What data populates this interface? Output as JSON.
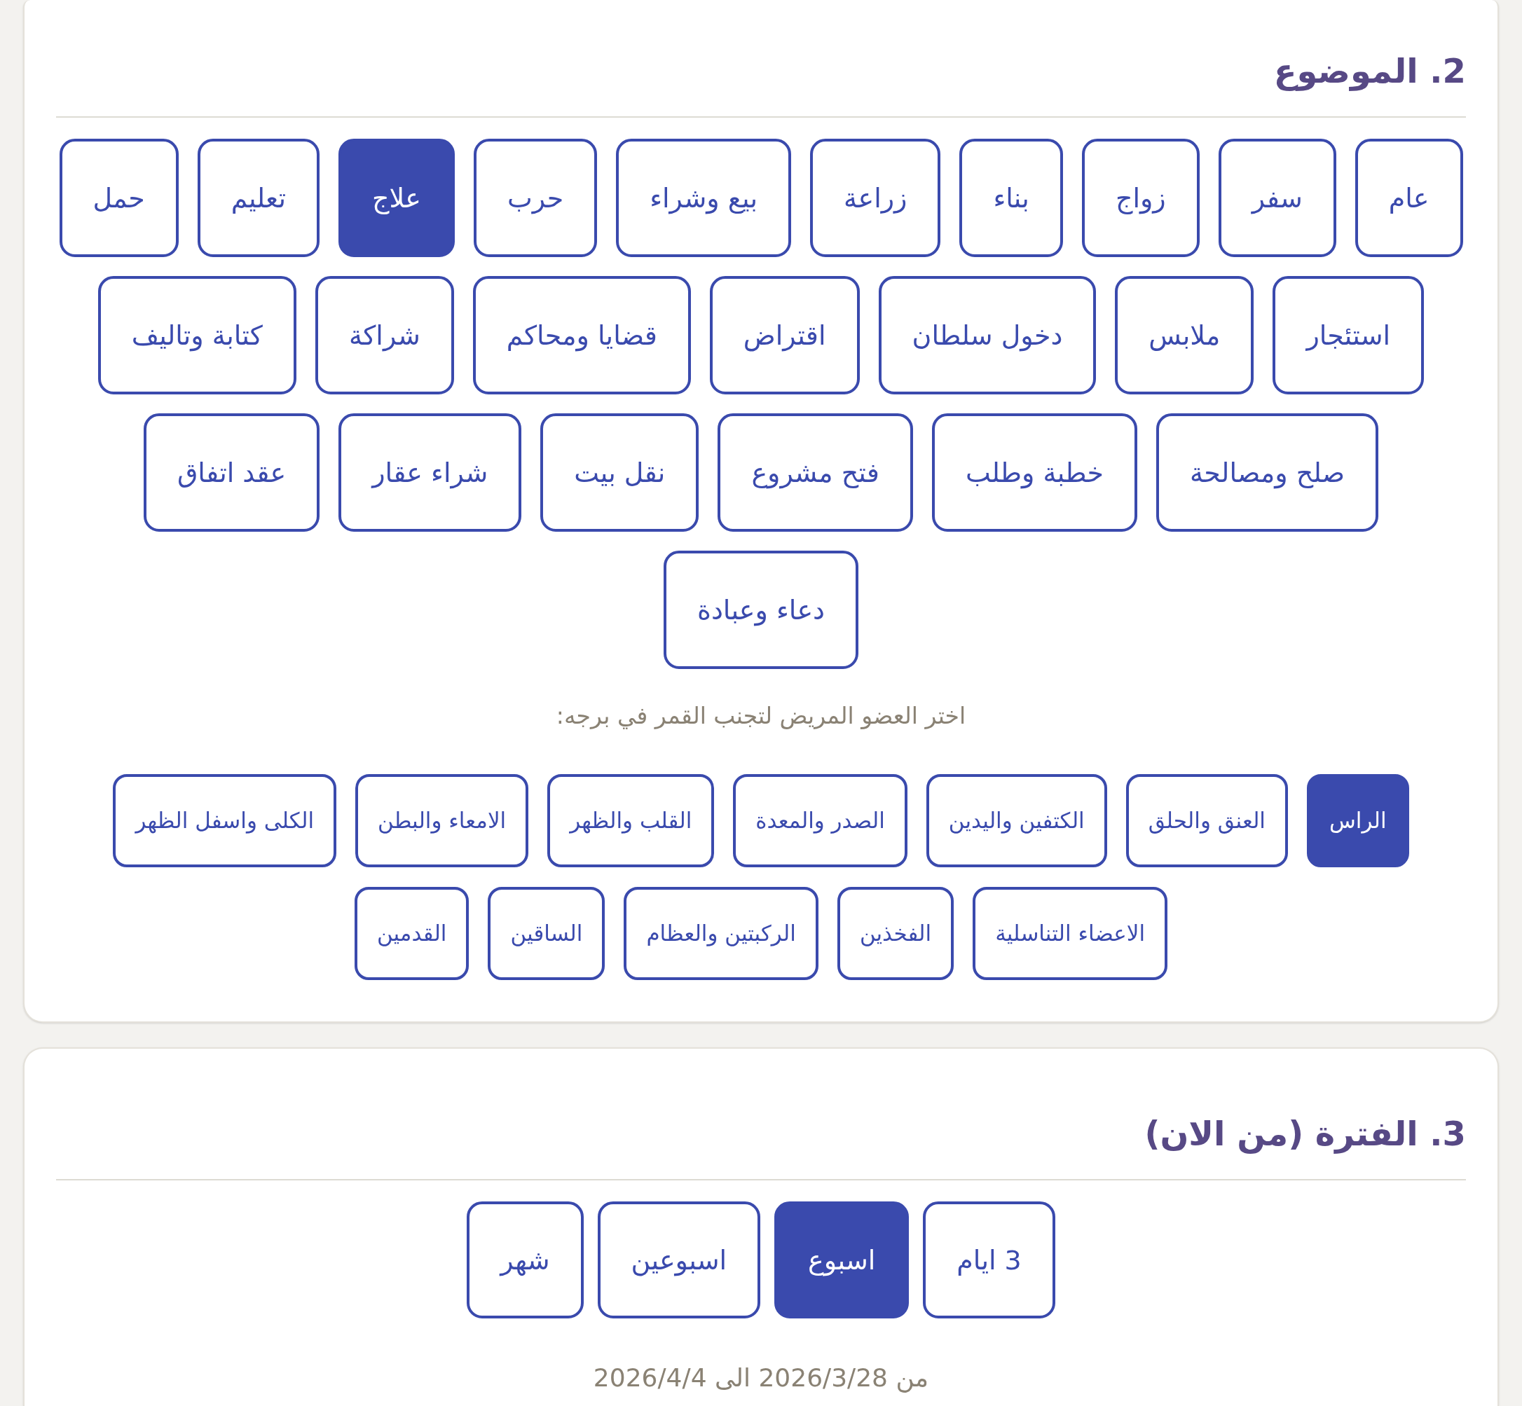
{
  "topic_section": {
    "title": "2. الموضوع",
    "topic_rows": [
      {
        "options": [
          {
            "label": "عام",
            "selected": false
          },
          {
            "label": "سفر",
            "selected": false
          },
          {
            "label": "زواج",
            "selected": false
          },
          {
            "label": "بناء",
            "selected": false
          },
          {
            "label": "زراعة",
            "selected": false
          },
          {
            "label": "بيع وشراء",
            "selected": false
          },
          {
            "label": "حرب",
            "selected": false
          },
          {
            "label": "علاج",
            "selected": true
          },
          {
            "label": "تعليم",
            "selected": false
          },
          {
            "label": "حمل",
            "selected": false
          }
        ]
      },
      {
        "options": [
          {
            "label": "استئجار",
            "selected": false
          },
          {
            "label": "ملابس",
            "selected": false
          },
          {
            "label": "دخول سلطان",
            "selected": false
          },
          {
            "label": "اقتراض",
            "selected": false
          },
          {
            "label": "قضايا ومحاكم",
            "selected": false
          },
          {
            "label": "شراكة",
            "selected": false
          },
          {
            "label": "كتابة وتاليف",
            "selected": false
          }
        ]
      },
      {
        "options": [
          {
            "label": "صلح ومصالحة",
            "selected": false
          },
          {
            "label": "خطبة وطلب",
            "selected": false
          },
          {
            "label": "فتح مشروع",
            "selected": false
          },
          {
            "label": "نقل بيت",
            "selected": false
          },
          {
            "label": "شراء عقار",
            "selected": false
          },
          {
            "label": "عقد اتفاق",
            "selected": false
          }
        ]
      },
      {
        "options": [
          {
            "label": "دعاء وعبادة",
            "selected": false
          }
        ]
      }
    ],
    "hint": "اختر العضو المريض لتجنب القمر في برجه:",
    "body_part_rows": [
      {
        "options": [
          {
            "label": "الراس",
            "selected": true
          },
          {
            "label": "العنق والحلق",
            "selected": false
          },
          {
            "label": "الكتفين واليدين",
            "selected": false
          },
          {
            "label": "الصدر والمعدة",
            "selected": false
          },
          {
            "label": "القلب والظهر",
            "selected": false
          },
          {
            "label": "الامعاء والبطن",
            "selected": false
          },
          {
            "label": "الكلى واسفل الظهر",
            "selected": false
          }
        ]
      },
      {
        "options": [
          {
            "label": "الاعضاء التناسلية",
            "selected": false
          },
          {
            "label": "الفخذين",
            "selected": false
          },
          {
            "label": "الركبتين والعظام",
            "selected": false
          },
          {
            "label": "الساقين",
            "selected": false
          },
          {
            "label": "القدمين",
            "selected": false
          }
        ]
      }
    ]
  },
  "period_section": {
    "title": "3. الفترة (من الان)",
    "options": [
      {
        "label": "3 ايام",
        "selected": false
      },
      {
        "label": "اسبوع",
        "selected": true
      },
      {
        "label": "اسبوعين",
        "selected": false
      },
      {
        "label": "شهر",
        "selected": false
      }
    ],
    "range": "من 2026/3/28 الى 2026/4/4"
  }
}
